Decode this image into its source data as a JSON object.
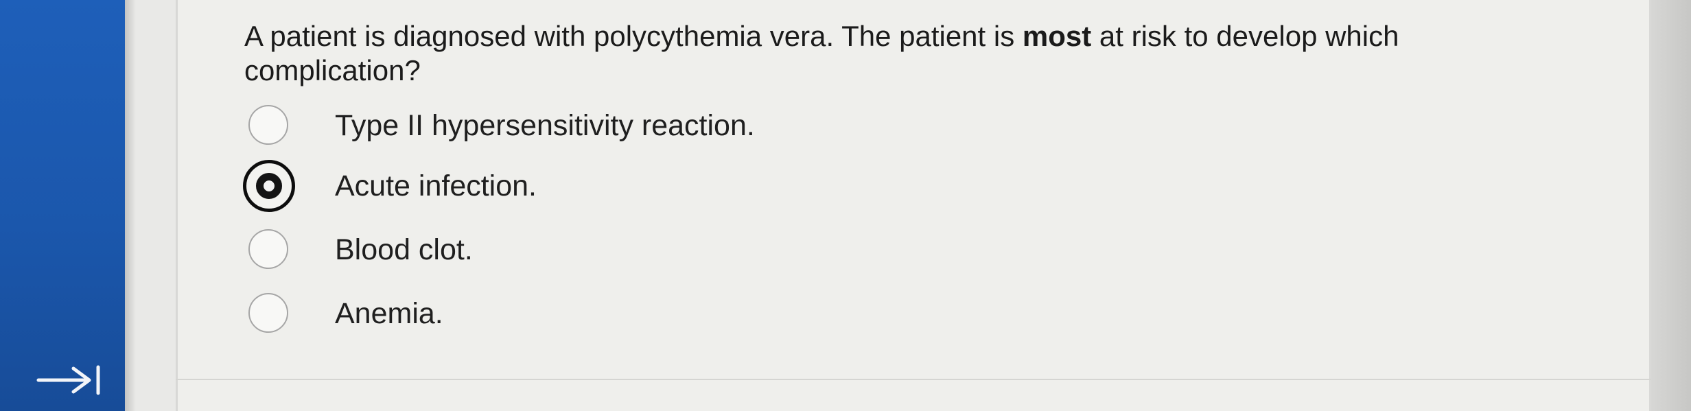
{
  "question": {
    "before": "A patient is diagnosed with polycythemia vera. The patient is ",
    "emphasis": "most",
    "after": " at risk to develop which complication?"
  },
  "options": [
    {
      "label": "Type II hypersensitivity reaction.",
      "selected": false
    },
    {
      "label": "Acute infection.",
      "selected": true
    },
    {
      "label": "Blood clot.",
      "selected": false
    },
    {
      "label": "Anemia.",
      "selected": false
    }
  ],
  "navigation": {
    "icon": "arrow-right-to-bar-icon"
  },
  "colors": {
    "rail": "#1b57ac",
    "panel": "#efefec",
    "text": "#1b1b1b",
    "selected_radio": "#111111"
  }
}
